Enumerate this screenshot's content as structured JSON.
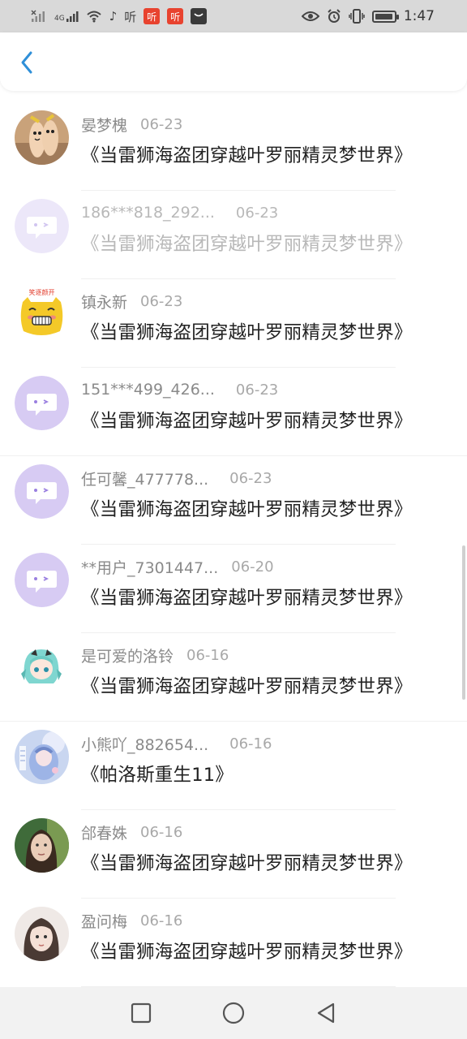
{
  "status_bar": {
    "time": "1:47",
    "network": "4G",
    "badges": [
      "听",
      "听",
      "听"
    ],
    "battery_level": 0.8,
    "icons": [
      "signal-icon",
      "signal-4g-icon",
      "wifi-icon",
      "music-note-icon",
      "ting-icon",
      "ting-red-icon",
      "ting-red-icon",
      "message-icon",
      "eye-icon",
      "alarm-icon",
      "vibrate-icon",
      "battery-icon"
    ]
  },
  "header": {
    "back_icon": "chevron-left-icon",
    "accent": "#2f8fd8"
  },
  "colors": {
    "placeholder_avatar_bg": "#d7cbf3",
    "placeholder_avatar_fg": "#ffffff",
    "placeholder_avatar_eye": "#9a7fe0"
  },
  "comments": [
    {
      "name": "晏梦槐",
      "date": "06-23",
      "book": "《当雷狮海盗团穿越叶罗丽精灵梦世界》",
      "avatar": "photo-fingers"
    },
    {
      "name": "186***818_292...",
      "date": "06-23",
      "book": "《当雷狮海盗团穿越叶罗丽精灵梦世界》",
      "avatar": "placeholder"
    },
    {
      "name": "镇永新",
      "date": "06-23",
      "book": "《当雷狮海盗团穿越叶罗丽精灵梦世界》",
      "avatar": "emoji-laugh",
      "avatar_text": "笑逐颜开"
    },
    {
      "name": "151***499_426...",
      "date": "06-23",
      "book": "《当雷狮海盗团穿越叶罗丽精灵梦世界》",
      "avatar": "placeholder"
    },
    {
      "name": "任可馨_477778...",
      "date": "06-23",
      "book": "《当雷狮海盗团穿越叶罗丽精灵梦世界》",
      "avatar": "placeholder"
    },
    {
      "name": "**用户_7301447...",
      "date": "06-20",
      "book": "《当雷狮海盗团穿越叶罗丽精灵梦世界》",
      "avatar": "placeholder"
    },
    {
      "name": "是可爱的洛铃",
      "date": "06-16",
      "book": "《当雷狮海盗团穿越叶罗丽精灵梦世界》",
      "avatar": "anime-girl"
    },
    {
      "name": "小熊吖_882654...",
      "date": "06-16",
      "book": "《帕洛斯重生11》",
      "avatar": "anime-blue"
    },
    {
      "name": "郃春姝",
      "date": "06-16",
      "book": "《当雷狮海盗团穿越叶罗丽精灵梦世界》",
      "avatar": "photo-girl-dark"
    },
    {
      "name": "盈问梅",
      "date": "06-16",
      "book": "《当雷狮海盗团穿越叶罗丽精灵梦世界》",
      "avatar": "photo-girl-light"
    }
  ],
  "nav": {
    "icons": [
      "recent-apps-icon",
      "home-icon",
      "back-triangle-icon"
    ]
  }
}
